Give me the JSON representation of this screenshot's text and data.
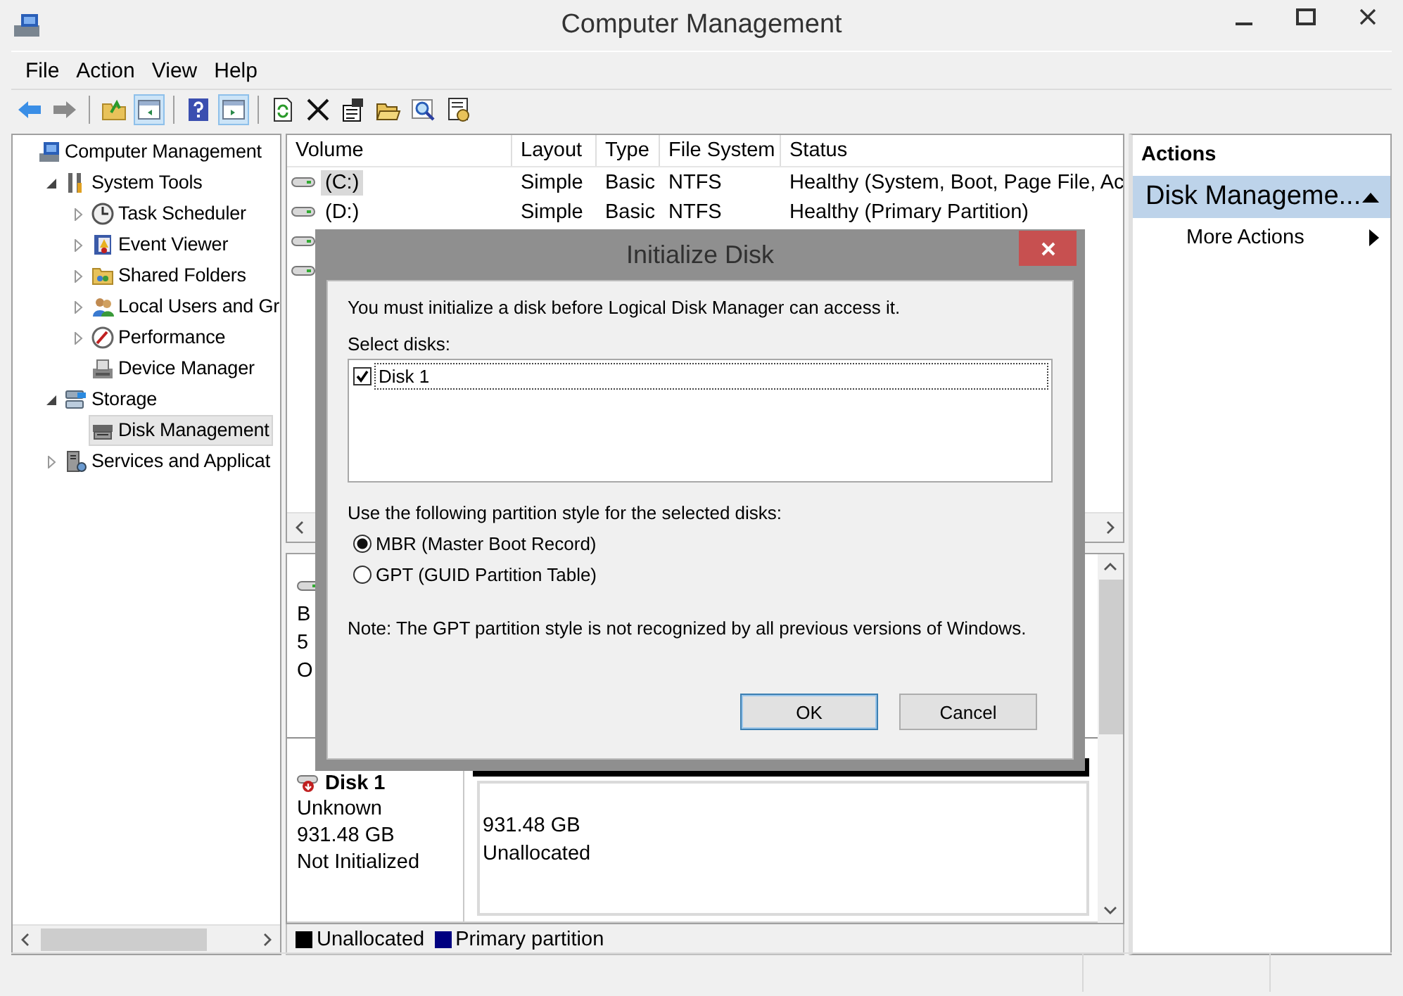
{
  "window": {
    "title": "Computer Management"
  },
  "menu": [
    "File",
    "Action",
    "View",
    "Help"
  ],
  "toolbar": [
    {
      "kind": "back",
      "pressed": false
    },
    {
      "kind": "forward",
      "pressed": false
    },
    {
      "kind": "separator"
    },
    {
      "kind": "folder-up",
      "pressed": false
    },
    {
      "kind": "tree-pane",
      "pressed": true
    },
    {
      "kind": "separator"
    },
    {
      "kind": "help",
      "pressed": false
    },
    {
      "kind": "action-pane",
      "pressed": true
    },
    {
      "kind": "separator"
    },
    {
      "kind": "refresh",
      "pressed": false
    },
    {
      "kind": "delete",
      "pressed": false
    },
    {
      "kind": "properties",
      "pressed": false
    },
    {
      "kind": "open",
      "pressed": false
    },
    {
      "kind": "search",
      "pressed": false
    },
    {
      "kind": "settings",
      "pressed": false
    }
  ],
  "tree": [
    {
      "label": "Computer Management",
      "selected": false,
      "children": [
        {
          "label": "System Tools",
          "selected": false,
          "expanded": true,
          "children": [
            {
              "label": "Task Scheduler",
              "selected": false,
              "expanded": false
            },
            {
              "label": "Event Viewer",
              "selected": false,
              "expanded": false
            },
            {
              "label": "Shared Folders",
              "selected": false,
              "expanded": false
            },
            {
              "label": "Local Users and Gr",
              "selected": false,
              "expanded": false
            },
            {
              "label": "Performance",
              "selected": false,
              "expanded": false
            },
            {
              "label": "Device Manager",
              "selected": false
            }
          ]
        },
        {
          "label": "Storage",
          "selected": false,
          "expanded": true,
          "children": [
            {
              "label": "Disk Management",
              "selected": true
            }
          ]
        },
        {
          "label": "Services and Applicat",
          "selected": false,
          "expanded": false
        }
      ]
    }
  ],
  "volumes": {
    "columns": [
      "Volume",
      "Layout",
      "Type",
      "File System",
      "Status"
    ],
    "rows": [
      {
        "cells": [
          "(C:)",
          "Simple",
          "Basic",
          "NTFS",
          "Healthy (System, Boot, Page File, Ac"
        ],
        "selected": true
      },
      {
        "cells": [
          "(D:)",
          "Simple",
          "Basic",
          "NTFS",
          "Healthy (Primary Partition)"
        ],
        "selected": false
      },
      {
        "selected": false
      },
      {
        "selected": false
      }
    ]
  },
  "disks": [
    {
      "lines": [
        "B",
        "5",
        "O"
      ]
    },
    {
      "name": "Disk 1",
      "lines": [
        "Unknown",
        "931.48 GB",
        "Not Initialized"
      ],
      "partition": {
        "kind": "unallocated",
        "size": "931.48 GB",
        "label": "Unallocated"
      }
    }
  ],
  "legend": [
    {
      "label": "Unallocated",
      "color": "#000000"
    },
    {
      "label": "Primary partition",
      "color": "#000080"
    }
  ],
  "actions": {
    "title": "Actions",
    "sections": [
      {
        "label": "Disk Manageme...",
        "expanded": true,
        "items": [
          "More Actions"
        ]
      }
    ]
  },
  "dialog": {
    "title": "Initialize Disk",
    "message": "You must initialize a disk before Logical Disk Manager can access it.",
    "select_label": "Select disks:",
    "disks": [
      {
        "label": "Disk 1",
        "checked": true,
        "selected": true
      }
    ],
    "style_label": "Use the following partition style for the selected disks:",
    "styles": [
      {
        "label": "MBR (Master Boot Record)",
        "selected": true
      },
      {
        "label": "GPT (GUID Partition Table)",
        "selected": false
      }
    ],
    "note": "Note: The GPT partition style is not recognized by all previous versions of Windows.",
    "buttons": [
      {
        "label": "OK",
        "default": true
      },
      {
        "label": "Cancel",
        "default": false
      }
    ]
  }
}
